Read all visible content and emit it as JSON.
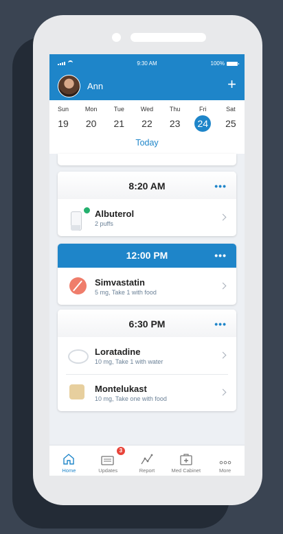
{
  "status_bar": {
    "time": "9:30 AM",
    "battery": "100%"
  },
  "header": {
    "user_name": "Ann",
    "add_icon": "plus-icon"
  },
  "calendar": {
    "days": [
      {
        "name": "Sun",
        "num": "19"
      },
      {
        "name": "Mon",
        "num": "20"
      },
      {
        "name": "Tue",
        "num": "21"
      },
      {
        "name": "Wed",
        "num": "22"
      },
      {
        "name": "Thu",
        "num": "23"
      },
      {
        "name": "Fri",
        "num": "24",
        "active": true
      },
      {
        "name": "Sat",
        "num": "25"
      }
    ],
    "today_label": "Today"
  },
  "schedule": [
    {
      "time": "8:20 AM",
      "active": false,
      "meds": [
        {
          "name": "Albuterol",
          "detail": "2 puffs",
          "icon": "inhaler-icon"
        }
      ]
    },
    {
      "time": "12:00 PM",
      "active": true,
      "meds": [
        {
          "name": "Simvastatin",
          "detail": "5 mg, Take 1 with food",
          "icon": "red-pill-icon"
        }
      ]
    },
    {
      "time": "6:30 PM",
      "active": false,
      "meds": [
        {
          "name": "Loratadine",
          "detail": "10 mg, Take 1 with water",
          "icon": "white-pill-icon"
        },
        {
          "name": "Montelukast",
          "detail": "10 mg, Take one with food",
          "icon": "tan-pill-icon"
        }
      ]
    }
  ],
  "tabbar": {
    "tabs": [
      {
        "label": "Home",
        "icon": "home-icon",
        "active": true
      },
      {
        "label": "Updates",
        "icon": "updates-icon",
        "badge": "3"
      },
      {
        "label": "Report",
        "icon": "report-icon"
      },
      {
        "label": "Med Cabinet",
        "icon": "med-cabinet-icon"
      },
      {
        "label": "More",
        "icon": "more-icon"
      }
    ]
  },
  "colors": {
    "accent": "#1e85c9",
    "badge": "#e8443a",
    "background": "#3a4452"
  }
}
